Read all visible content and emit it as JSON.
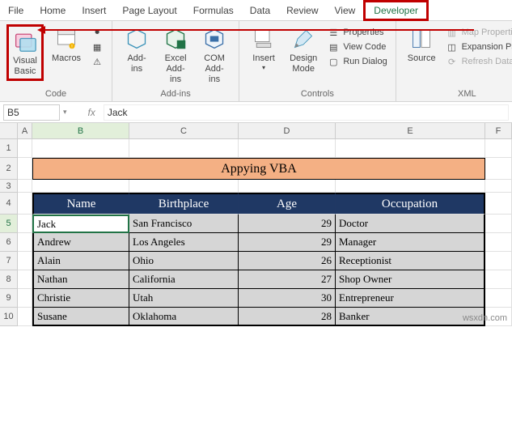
{
  "tabs": {
    "items": [
      "File",
      "Home",
      "Insert",
      "Page Layout",
      "Formulas",
      "Data",
      "Review",
      "View",
      "Developer"
    ],
    "active": "Developer"
  },
  "ribbon": {
    "code": {
      "label": "Code",
      "visual_basic": "Visual\nBasic",
      "macros": "Macros"
    },
    "addins": {
      "label": "Add-ins",
      "addins": "Add-\nins",
      "excel_addins": "Excel\nAdd-ins",
      "com_addins": "COM\nAdd-ins"
    },
    "controls": {
      "label": "Controls",
      "insert": "Insert",
      "design_mode": "Design\nMode",
      "properties": "Properties",
      "view_code": "View Code",
      "run_dialog": "Run Dialog"
    },
    "xml": {
      "label": "XML",
      "source": "Source",
      "map_properties": "Map Properties",
      "expansion_packs": "Expansion Packs",
      "refresh_data": "Refresh Data"
    }
  },
  "namebox": {
    "value": "B5"
  },
  "formula": {
    "fx": "fx",
    "value": "Jack"
  },
  "columns": {
    "A": "A",
    "B": "B",
    "C": "C",
    "D": "D",
    "E": "E",
    "F": "F"
  },
  "rows": [
    "1",
    "2",
    "3",
    "4",
    "5",
    "6",
    "7",
    "8",
    "9",
    "10"
  ],
  "title": "Appying VBA",
  "headers": {
    "name": "Name",
    "birthplace": "Birthplace",
    "age": "Age",
    "occupation": "Occupation"
  },
  "data": [
    {
      "name": "Jack",
      "birthplace": "San Francisco",
      "age": "29",
      "occupation": "Doctor"
    },
    {
      "name": "Andrew",
      "birthplace": "Los Angeles",
      "age": "29",
      "occupation": "Manager"
    },
    {
      "name": "Alain",
      "birthplace": "Ohio",
      "age": "26",
      "occupation": "Receptionist"
    },
    {
      "name": "Nathan",
      "birthplace": "California",
      "age": "27",
      "occupation": "Shop Owner"
    },
    {
      "name": "Christie",
      "birthplace": "Utah",
      "age": "30",
      "occupation": "Entrepreneur"
    },
    {
      "name": "Susane",
      "birthplace": "Oklahoma",
      "age": "28",
      "occupation": "Banker"
    }
  ],
  "watermark": "wsxdn.com"
}
